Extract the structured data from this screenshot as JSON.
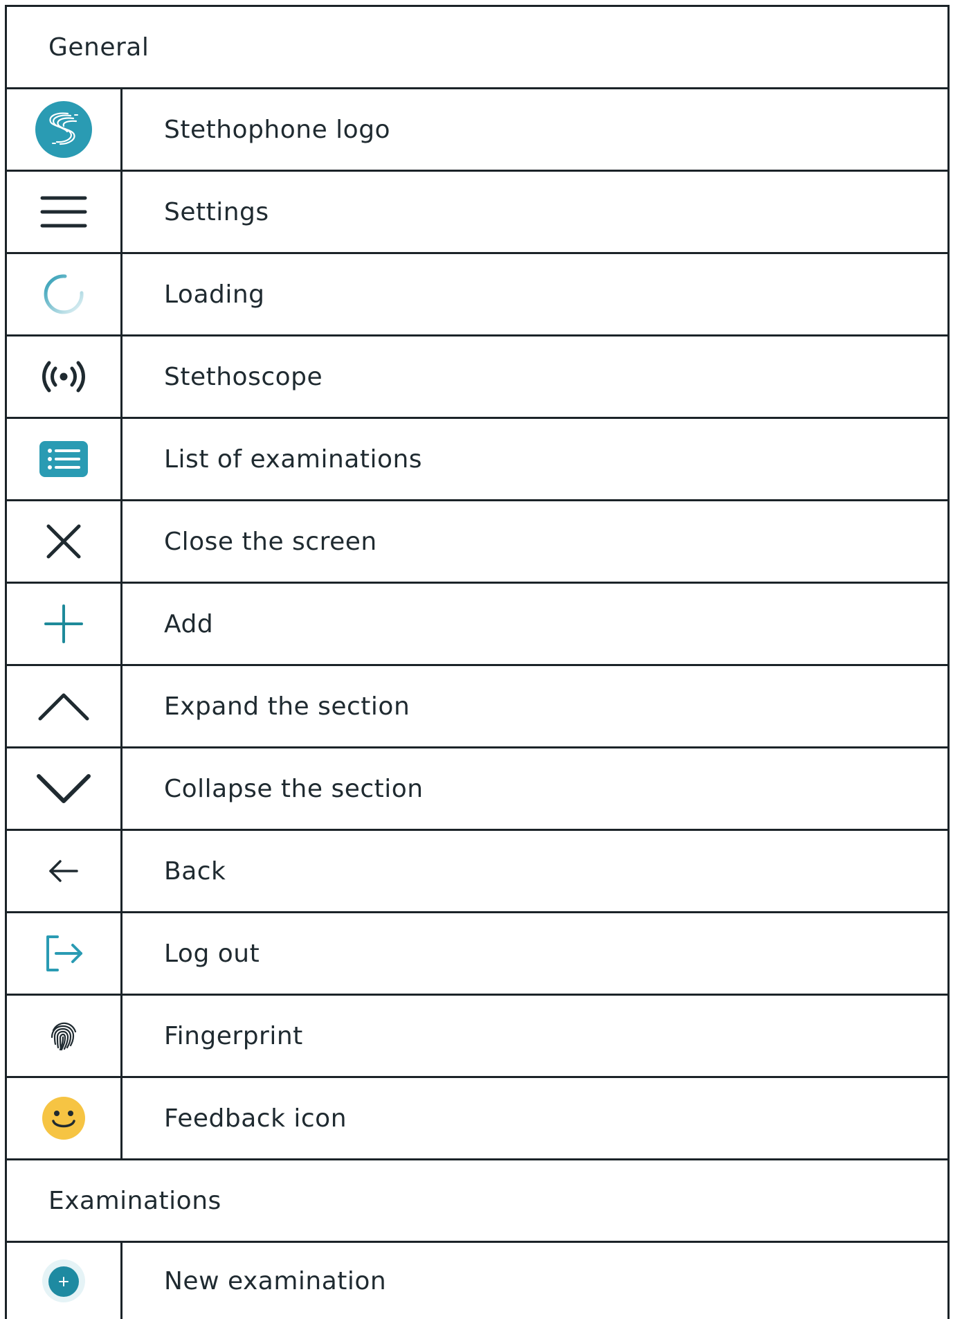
{
  "sections": {
    "general": {
      "title": "General",
      "rows": [
        {
          "icon": "stethophone-logo-icon",
          "label": "Stethophone logo"
        },
        {
          "icon": "menu-icon",
          "label": "Settings"
        },
        {
          "icon": "loading-spinner-icon",
          "label": "Loading"
        },
        {
          "icon": "broadcast-icon",
          "label": "Stethoscope"
        },
        {
          "icon": "list-icon",
          "label": "List of examinations"
        },
        {
          "icon": "close-icon",
          "label": "Close the screen"
        },
        {
          "icon": "plus-icon",
          "label": "Add"
        },
        {
          "icon": "chevron-up-icon",
          "label": "Expand the section"
        },
        {
          "icon": "chevron-down-icon",
          "label": "Collapse the section"
        },
        {
          "icon": "arrow-left-icon",
          "label": "Back"
        },
        {
          "icon": "logout-icon",
          "label": "Log out"
        },
        {
          "icon": "fingerprint-icon",
          "label": "Fingerprint"
        },
        {
          "icon": "smiley-icon",
          "label": "Feedback icon"
        }
      ]
    },
    "examinations": {
      "title": "Examinations",
      "rows": [
        {
          "icon": "new-examination-icon",
          "label": "New examination"
        }
      ]
    }
  },
  "colors": {
    "teal": "#2a9bb3",
    "dark": "#1f2a30",
    "yellow": "#f6c443"
  }
}
